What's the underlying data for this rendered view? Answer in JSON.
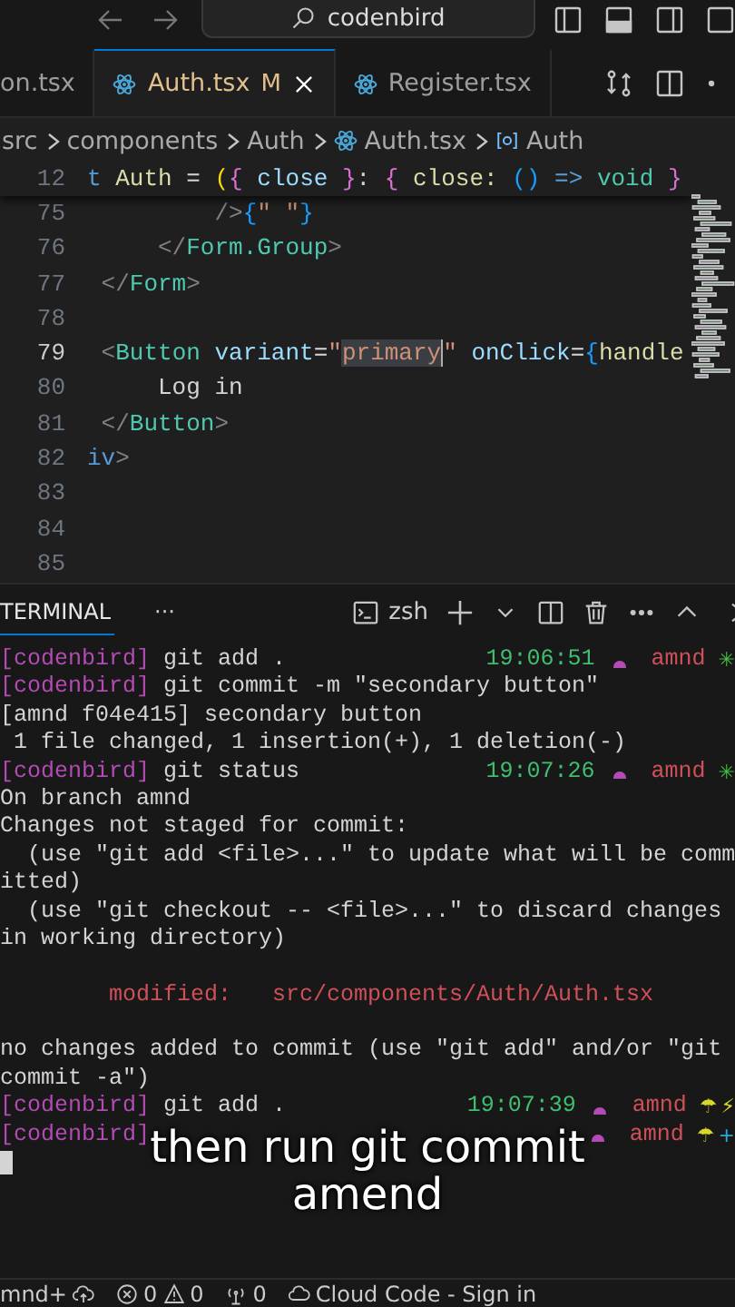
{
  "title_bar": {
    "search": "codenbird"
  },
  "tabs": [
    {
      "label": "on.tsx",
      "react_icon": false,
      "selected": false,
      "modified": false
    },
    {
      "label": "Auth.tsx",
      "react_icon": true,
      "badge": "M",
      "selected": true,
      "modified": true
    },
    {
      "label": "Register.tsx",
      "react_icon": true,
      "selected": false,
      "modified": false
    }
  ],
  "breadcrumb": [
    {
      "label": "src",
      "kind": "folder"
    },
    {
      "label": "components",
      "kind": "folder"
    },
    {
      "label": "Auth",
      "kind": "folder"
    },
    {
      "label": "Auth.tsx",
      "kind": "file"
    },
    {
      "label": "Auth",
      "kind": "symbol"
    }
  ],
  "editor": {
    "sticky_line": {
      "number": "12",
      "current": false,
      "tokens": [
        {
          "text": "t ",
          "kind": "kw"
        },
        {
          "text": "Auth",
          "kind": "fn"
        },
        {
          "text": " = ",
          "kind": "plain"
        },
        {
          "text": "(",
          "kind": "brace1"
        },
        {
          "text": "{",
          "kind": "brace2"
        },
        {
          "text": " close ",
          "kind": "param"
        },
        {
          "text": "}",
          "kind": "brace2"
        },
        {
          "text": ": ",
          "kind": "plain"
        },
        {
          "text": "{",
          "kind": "brace2"
        },
        {
          "text": " close: ",
          "kind": "fn"
        },
        {
          "text": "()",
          "kind": "brace3"
        },
        {
          "text": " => ",
          "kind": "kw"
        },
        {
          "text": "void",
          "kind": "tag"
        },
        {
          "text": " }",
          "kind": "brace2"
        }
      ]
    },
    "lines": [
      {
        "number": "75",
        "current": false,
        "tokens": [
          {
            "text": "         />",
            "kind": "punct"
          },
          {
            "text": "{",
            "kind": "brace3"
          },
          {
            "text": "\" \"",
            "kind": "string"
          },
          {
            "text": "}",
            "kind": "brace3"
          }
        ]
      },
      {
        "number": "76",
        "current": false,
        "tokens": [
          {
            "text": "     </",
            "kind": "punct"
          },
          {
            "text": "Form.Group",
            "kind": "tag"
          },
          {
            "text": ">",
            "kind": "punct"
          }
        ]
      },
      {
        "number": "77",
        "current": false,
        "tokens": [
          {
            "text": " </",
            "kind": "punct"
          },
          {
            "text": "Form",
            "kind": "tag"
          },
          {
            "text": ">",
            "kind": "punct"
          }
        ]
      },
      {
        "number": "78",
        "current": false
      },
      {
        "number": "79",
        "current": true,
        "tokens": [
          {
            "text": " <",
            "kind": "punct"
          },
          {
            "text": "Button",
            "kind": "tag"
          },
          {
            "text": " variant",
            "kind": "param"
          },
          {
            "text": "=",
            "kind": "plain"
          },
          {
            "text": "\"",
            "kind": "string"
          },
          {
            "text": "primary",
            "kind": "match"
          },
          {
            "text": "\"",
            "kind": "string"
          },
          {
            "text": " onClick",
            "kind": "param"
          },
          {
            "text": "=",
            "kind": "plain"
          },
          {
            "text": "{",
            "kind": "brace3"
          },
          {
            "text": "handle",
            "kind": "fn"
          }
        ]
      },
      {
        "number": "80",
        "current": false,
        "tokens": [
          {
            "text": "     Log in",
            "kind": "plain"
          }
        ]
      },
      {
        "number": "81",
        "current": false,
        "tokens": [
          {
            "text": " </",
            "kind": "punct"
          },
          {
            "text": "Button",
            "kind": "tag"
          },
          {
            "text": ">",
            "kind": "punct"
          }
        ]
      },
      {
        "number": "82",
        "current": false,
        "tokens": [
          {
            "text": "iv",
            "kind": "kw"
          },
          {
            "text": ">",
            "kind": "punct"
          }
        ]
      },
      {
        "number": "83",
        "current": false
      },
      {
        "number": "84",
        "current": false
      },
      {
        "number": "85",
        "current": false
      }
    ]
  },
  "panel": {
    "tab": "TERMINAL",
    "more": "···",
    "shell": "zsh"
  },
  "terminal": [
    {
      "kind": "prompt",
      "user": "[codenbird]",
      "command": " git add .",
      "time": "19:06:51",
      "branch": "amnd",
      "status": [
        {
          "glyph": "✳",
          "color": "#3fbf3f"
        }
      ]
    },
    {
      "kind": "prompt",
      "user": "[codenbird]",
      "command": " git commit -m \"secondary button\""
    },
    {
      "kind": "output",
      "text": "[amnd f04e415] secondary button"
    },
    {
      "kind": "output",
      "text": " 1 file changed, 1 insertion(+), 1 deletion(-)"
    },
    {
      "kind": "prompt",
      "user": "[codenbird]",
      "command": " git status",
      "time": "19:07:26",
      "branch": "amnd",
      "status": [
        {
          "glyph": "✳",
          "color": "#3fbf3f"
        }
      ]
    },
    {
      "kind": "output",
      "text": "On branch amnd"
    },
    {
      "kind": "output",
      "text": "Changes not staged for commit:"
    },
    {
      "kind": "output",
      "text": "  (use \"git add <file>...\" to update what will be comm"
    },
    {
      "kind": "output",
      "text": "itted)"
    },
    {
      "kind": "output",
      "text": "  (use \"git checkout -- <file>...\" to discard changes"
    },
    {
      "kind": "output",
      "text": "in working directory)"
    },
    {
      "kind": "blank"
    },
    {
      "kind": "modified",
      "text": "        modified:   src/components/Auth/Auth.tsx"
    },
    {
      "kind": "blank"
    },
    {
      "kind": "output",
      "text": "no changes added to commit (use \"git add\" and/or \"git"
    },
    {
      "kind": "output",
      "text": "commit -a\")"
    },
    {
      "kind": "prompt",
      "user": "[codenbird]",
      "command": " git add .",
      "time": "19:07:39",
      "branch": "amnd",
      "status": [
        {
          "glyph": "☂",
          "color": "#d8d82a"
        },
        {
          "glyph": "⚡",
          "color": "#d8d82a"
        }
      ]
    },
    {
      "kind": "prompt",
      "user": "[codenbird]",
      "branch": "amnd",
      "status": [
        {
          "glyph": "☂",
          "color": "#d8d82a"
        },
        {
          "glyph": "+",
          "color": "#2aa8d8"
        }
      ]
    },
    {
      "kind": "cursor"
    }
  ],
  "subtitle": [
    "then run git commit",
    "amend"
  ],
  "status_bar": {
    "branch": "mnd+",
    "errors": "0",
    "warnings": "0",
    "ports": "0",
    "cloud": "Cloud Code - Sign in"
  }
}
